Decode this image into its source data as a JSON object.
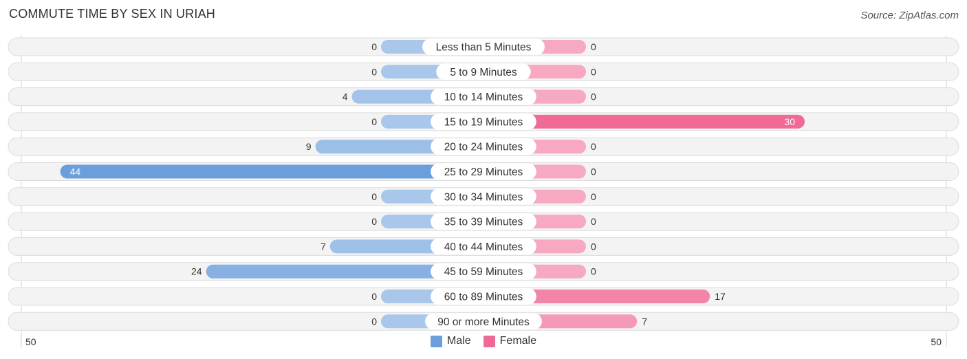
{
  "header": {
    "title": "COMMUTE TIME BY SEX IN URIAH",
    "source": "Source: ZipAtlas.com"
  },
  "legend": [
    {
      "name": "Male",
      "color": "#6a9fdb"
    },
    {
      "name": "Female",
      "color": "#f06a95"
    }
  ],
  "axis": {
    "left_label": "50",
    "right_label": "50"
  },
  "chart_data": {
    "type": "bar",
    "orientation": "horizontal-diverging",
    "title": "COMMUTE TIME BY SEX IN URIAH",
    "categories": [
      "Less than 5 Minutes",
      "5 to 9 Minutes",
      "10 to 14 Minutes",
      "15 to 19 Minutes",
      "20 to 24 Minutes",
      "25 to 29 Minutes",
      "30 to 34 Minutes",
      "35 to 39 Minutes",
      "40 to 44 Minutes",
      "45 to 59 Minutes",
      "60 to 89 Minutes",
      "90 or more Minutes"
    ],
    "series": [
      {
        "name": "Male",
        "values": [
          0,
          0,
          4,
          0,
          9,
          44,
          0,
          0,
          7,
          24,
          0,
          0
        ]
      },
      {
        "name": "Female",
        "values": [
          0,
          0,
          0,
          30,
          0,
          0,
          0,
          0,
          0,
          0,
          17,
          7
        ]
      }
    ],
    "xlim": [
      -50,
      50
    ],
    "tick_labels": [
      "50",
      "50"
    ],
    "legend_position": "bottom-center"
  }
}
